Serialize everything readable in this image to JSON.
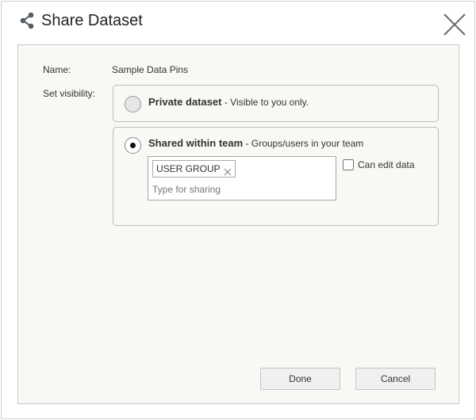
{
  "dialog": {
    "title": "Share Dataset",
    "icon": "share-icon",
    "close_icon": "close-icon"
  },
  "form": {
    "name_label": "Name:",
    "name_value": "Sample Data Pins",
    "visibility_label": "Set visibility:"
  },
  "options": {
    "private": {
      "title": "Private dataset",
      "description": " - Visible to you only.",
      "selected": false
    },
    "team": {
      "title": "Shared within team",
      "description": " - Groups/users in your team",
      "selected": true,
      "chips": [
        "USER GROUP"
      ],
      "input_placeholder": "Type for sharing",
      "can_edit_label": "Can edit data",
      "can_edit_checked": false
    }
  },
  "buttons": {
    "done": "Done",
    "cancel": "Cancel"
  },
  "colors": {
    "panel_bg": "#faf8f4",
    "border": "#c9c9c9",
    "button_bg": "#f0f0f0"
  }
}
